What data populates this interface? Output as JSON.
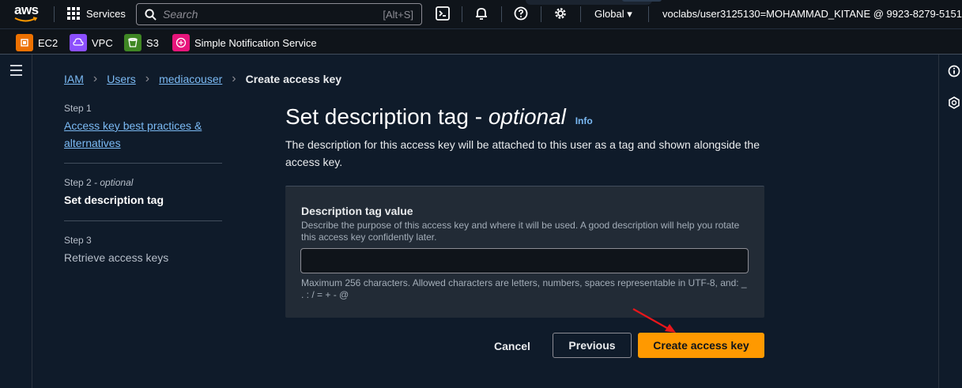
{
  "topnav": {
    "logo_text": "aws",
    "services_label": "Services",
    "search_placeholder": "Search",
    "search_shortcut": "[Alt+S]",
    "region": "Global",
    "account": "voclabs/user3125130=MOHAMMAD_KITANE @ 9923-8279-5151"
  },
  "favorites": [
    {
      "label": "EC2",
      "color": "#ed7100"
    },
    {
      "label": "VPC",
      "color": "#8c4fff"
    },
    {
      "label": "S3",
      "color": "#3f8624"
    },
    {
      "label": "Simple Notification Service",
      "color": "#e7157b"
    }
  ],
  "breadcrumb": {
    "items": [
      "IAM",
      "Users",
      "mediacouser"
    ],
    "current": "Create access key"
  },
  "steps": [
    {
      "num": "Step 1",
      "label": "Access key best practices & alternatives"
    },
    {
      "num": "Step 2",
      "num_suffix": "- optional",
      "label": "Set description tag"
    },
    {
      "num": "Step 3",
      "label": "Retrieve access keys"
    }
  ],
  "main": {
    "title": "Set description tag - ",
    "title_optional": "optional",
    "info": "Info",
    "description": "The description for this access key will be attached to this user as a tag and shown alongside the access key.",
    "field_label": "Description tag value",
    "field_hint": "Describe the purpose of this access key and where it will be used. A good description will help you rotate this access key confidently later.",
    "field_value": "",
    "constraint": "Maximum 256 characters. Allowed characters are letters, numbers, spaces representable in UTF-8, and: _ . : / = + - @"
  },
  "actions": {
    "cancel": "Cancel",
    "previous": "Previous",
    "create": "Create access key"
  },
  "colors": {
    "accent": "#ff9900",
    "link": "#7bbaf4"
  }
}
